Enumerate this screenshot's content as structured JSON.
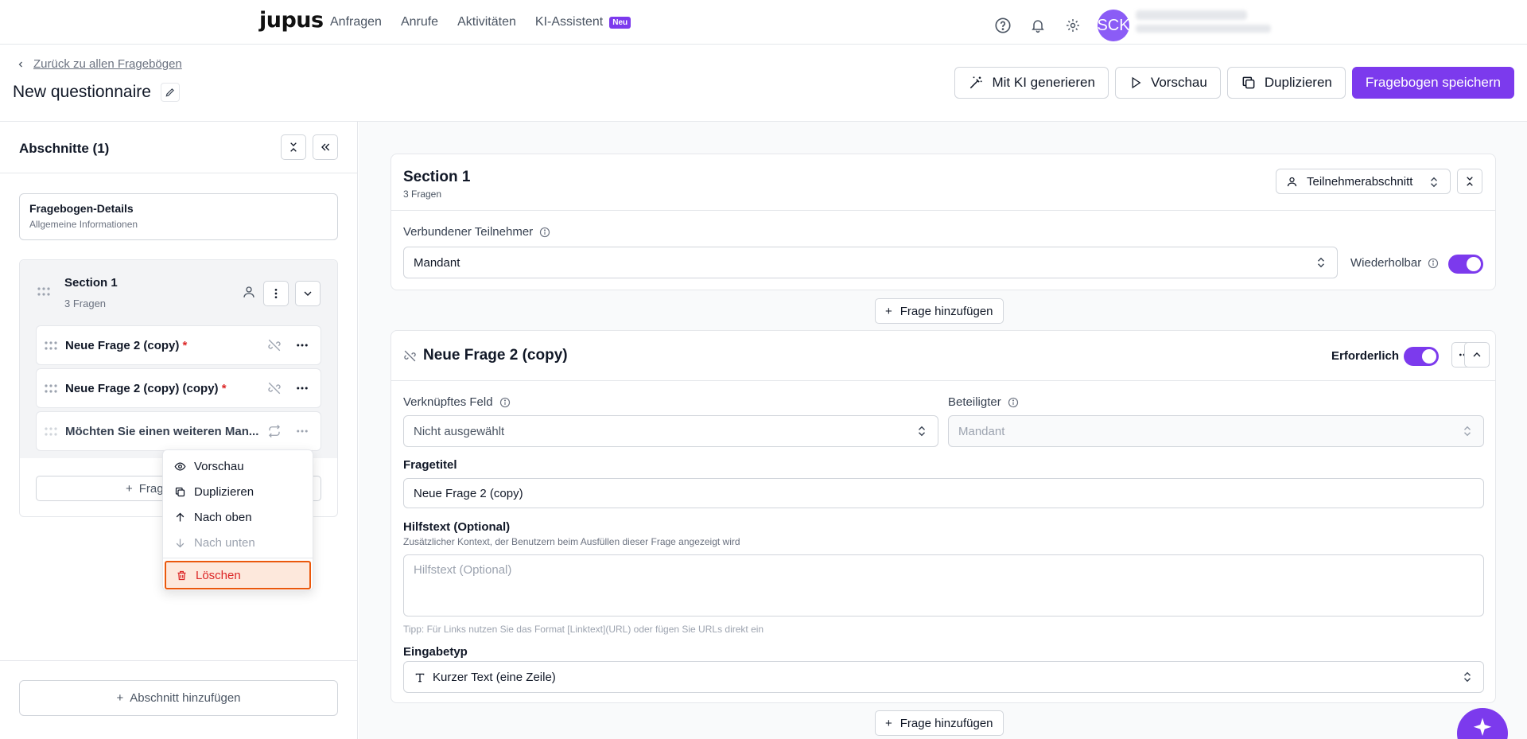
{
  "nav": {
    "logo": "jupus",
    "links": [
      {
        "label": "Anfragen"
      },
      {
        "label": "Anrufe"
      },
      {
        "label": "Aktivitäten"
      },
      {
        "label": "KI-Assistent",
        "badge": "Neu"
      }
    ],
    "avatar_initials": "SCK"
  },
  "header": {
    "back_label": "Zurück zu allen Fragebögen",
    "title": "New questionnaire",
    "actions": {
      "generate": "Mit KI generieren",
      "preview": "Vorschau",
      "duplicate": "Duplizieren",
      "save": "Fragebogen speichern"
    }
  },
  "sidebar": {
    "title": "Abschnitte (1)",
    "details": {
      "title": "Fragebogen-Details",
      "subtitle": "Allgemeine Informationen"
    },
    "section": {
      "name": "Section 1",
      "count": "3 Fragen",
      "questions": [
        {
          "label": "Neue Frage 2 (copy)",
          "required": "*"
        },
        {
          "label": "Neue Frage 2 (copy) (copy)",
          "required": "*"
        },
        {
          "label": "Möchten Sie einen weiteren Man...",
          "required": ""
        }
      ],
      "add_question": "Frage"
    },
    "add_section": "Abschnitt hinzufügen"
  },
  "context_menu": {
    "items": [
      {
        "label": "Vorschau",
        "icon": "eye-icon",
        "disabled": false
      },
      {
        "label": "Duplizieren",
        "icon": "copy-icon",
        "disabled": false
      },
      {
        "label": "Nach oben",
        "icon": "arrow-up-icon",
        "disabled": false
      },
      {
        "label": "Nach unten",
        "icon": "arrow-down-icon",
        "disabled": true
      }
    ],
    "delete": "Löschen"
  },
  "main": {
    "section": {
      "title": "Section 1",
      "count": "3 Fragen",
      "type_select": "Teilnehmerabschnitt",
      "linked_participant_label": "Verbundener Teilnehmer",
      "linked_participant_value": "Mandant",
      "repeatable_label": "Wiederholbar",
      "repeatable": true
    },
    "add_question": "Frage hinzufügen",
    "question": {
      "title": "Neue Frage 2 (copy)",
      "required_label": "Erforderlich",
      "required": true,
      "linked_field_label": "Verknüpftes Feld",
      "linked_field_value": "Nicht ausgewählt",
      "participant_label": "Beteiligter",
      "participant_value": "Mandant",
      "title_label": "Fragetitel",
      "title_value": "Neue Frage 2 (copy)",
      "help_label": "Hilfstext (Optional)",
      "help_desc": "Zusätzlicher Kontext, der Benutzern beim Ausfüllen dieser Frage angezeigt wird",
      "help_placeholder": "Hilfstext (Optional)",
      "help_tip": "Tipp: Für Links nutzen Sie das Format [Linktext](URL) oder fügen Sie URLs direkt ein",
      "input_type_label": "Eingabetyp",
      "input_type_value": "Kurzer Text (eine Zeile)"
    }
  },
  "colors": {
    "accent": "#7c3aed",
    "danger": "#dc2626",
    "danger_bg": "#fde8dc",
    "focus": "#ea580c"
  }
}
